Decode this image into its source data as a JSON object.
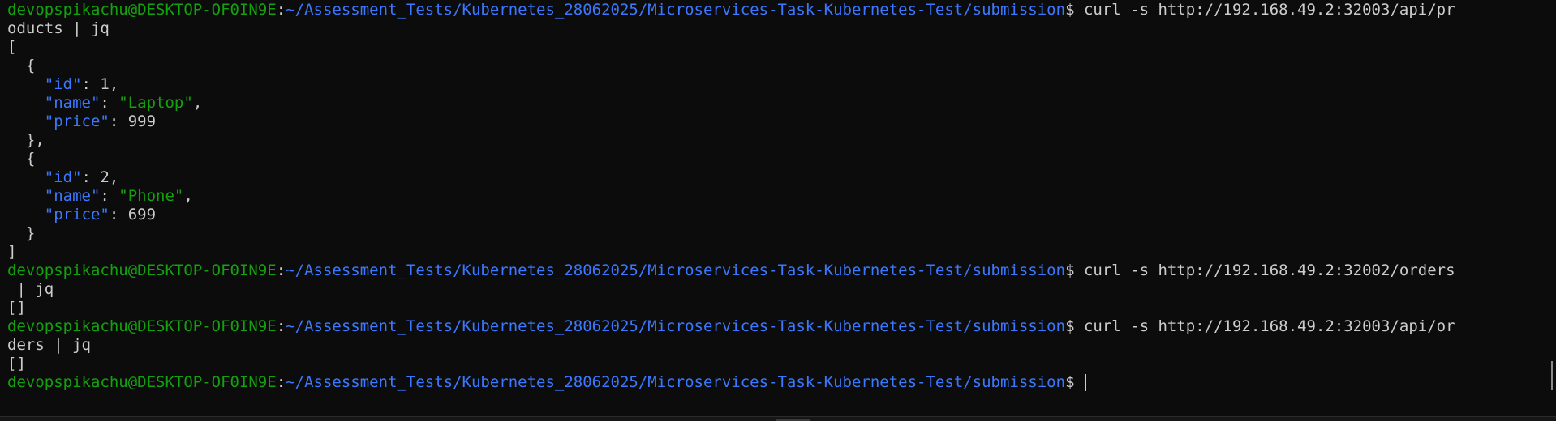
{
  "prompt": {
    "user_host": "devopspikachu@DESKTOP-OF0IN9E",
    "separator": ":",
    "path": "~/Assessment_Tests/Kubernetes_28062025/Microservices-Task-Kubernetes-Test/submission",
    "symbol": "$ "
  },
  "commands": [
    {
      "first": "curl -s http://192.168.49.2:32003/api/pr",
      "wrap": "oducts | jq"
    },
    {
      "first": "curl -s http://192.168.49.2:32002/orders",
      "wrap": " | jq"
    },
    {
      "first": "curl -s http://192.168.49.2:32003/api/or",
      "wrap": "ders | jq"
    }
  ],
  "json_output": {
    "open_array": "[",
    "close_array": "]",
    "open_obj": "  {",
    "close_obj_comma": "  },",
    "close_obj": "  }",
    "items": [
      {
        "id": "1",
        "name": "\"Laptop\"",
        "price": "999"
      },
      {
        "id": "2",
        "name": "\"Phone\"",
        "price": "699"
      }
    ],
    "keys": {
      "id": "\"id\"",
      "name": "\"name\"",
      "price": "\"price\""
    }
  },
  "outputs": {
    "orders_result": "[]",
    "api_orders_result": "[]"
  },
  "colors": {
    "background": "#0c0c0c",
    "user_host": "#13a10e",
    "path": "#3b78ff",
    "text": "#cccccc"
  }
}
